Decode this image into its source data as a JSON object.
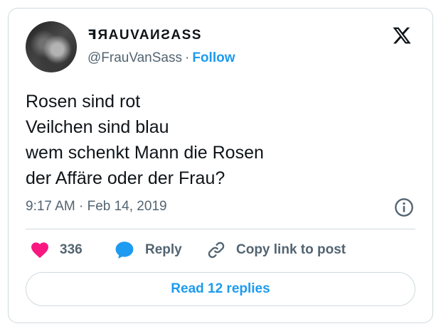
{
  "author": {
    "display_name": "ꟻЯAUVAИƧASS",
    "handle": "@FrauVanSass",
    "separator": "·",
    "follow_label": "Follow"
  },
  "tweet": {
    "lines": [
      "Rosen sind rot",
      "Veilchen sind blau",
      "wem schenkt Mann die Rosen",
      "der Affäre oder der Frau?"
    ],
    "timestamp": "9:17 AM · Feb 14, 2019"
  },
  "actions": {
    "like_count": "336",
    "reply_label": "Reply",
    "copy_link_label": "Copy link to post"
  },
  "read_replies_label": "Read 12 replies",
  "colors": {
    "accent": "#1d9bf0",
    "like": "#f91880",
    "text": "#0f1419",
    "secondary": "#536471",
    "border": "#cfd9de"
  },
  "icons": {
    "brand": "x-logo-icon",
    "info": "info-icon",
    "like": "heart-icon",
    "reply": "speech-bubble-icon",
    "copy": "link-icon"
  }
}
